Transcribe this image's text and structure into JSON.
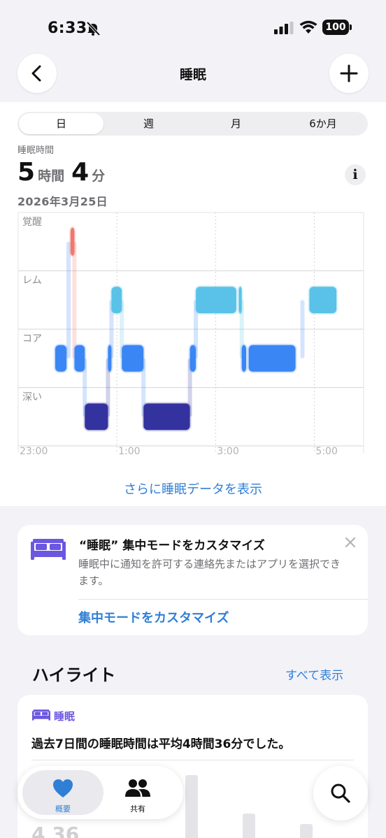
{
  "status_bar": {
    "time": "6:33",
    "battery": "100",
    "icons": [
      "bell-slash-icon",
      "signal-icon",
      "wifi-icon",
      "battery-icon"
    ]
  },
  "nav": {
    "title": "睡眠",
    "back_icon": "chevron-left-icon",
    "add_icon": "plus-icon"
  },
  "segments": [
    "日",
    "週",
    "月",
    "6か月"
  ],
  "selected_segment": "日",
  "summary": {
    "label": "睡眠時間",
    "hours": "5",
    "hours_unit": "時間",
    "minutes": "4",
    "minutes_unit": "分",
    "date": "2026年3月25日",
    "info_label": "i"
  },
  "chart_data": {
    "type": "bar",
    "stages": [
      "覚醒",
      "レム",
      "コア",
      "深い"
    ],
    "x_ticks": [
      "23:00",
      "1:00",
      "3:00",
      "5:00"
    ],
    "segments": [
      {
        "stage": "コア",
        "start": 23.75,
        "end": 23.98
      },
      {
        "stage": "覚醒",
        "start": 24.06,
        "end": 24.14
      },
      {
        "stage": "コア",
        "start": 24.14,
        "end": 24.35
      },
      {
        "stage": "深い",
        "start": 24.35,
        "end": 24.82
      },
      {
        "stage": "コア",
        "start": 24.82,
        "end": 24.89
      },
      {
        "stage": "レム",
        "start": 24.89,
        "end": 25.1
      },
      {
        "stage": "コア",
        "start": 25.1,
        "end": 25.54
      },
      {
        "stage": "深い",
        "start": 25.54,
        "end": 26.48
      },
      {
        "stage": "コア",
        "start": 26.48,
        "end": 26.6
      },
      {
        "stage": "レム",
        "start": 26.6,
        "end": 27.42
      },
      {
        "stage": "レム",
        "start": 27.47,
        "end": 27.53
      },
      {
        "stage": "コア",
        "start": 27.53,
        "end": 27.62
      },
      {
        "stage": "コア",
        "start": 27.67,
        "end": 28.62
      },
      {
        "stage": "レム",
        "start": 28.9,
        "end": 29.45
      }
    ],
    "colors": {
      "覚醒": "#f0786a",
      "レム": "#5ac2e8",
      "コア": "#3a86f5",
      "深い": "#34329e"
    },
    "grid": true
  },
  "more_link": "さらに睡眠データを表示",
  "focus_card": {
    "title": "“睡眠” 集中モードをカスタマイズ",
    "description": "睡眠中に通知を許可する連絡先またはアプリを選択できます。",
    "link": "集中モードをカスタマイズ",
    "icon": "bed-icon",
    "close_icon": "close-icon"
  },
  "highlights": {
    "title": "ハイライト",
    "show_all": "すべて表示",
    "card": {
      "category": "睡眠",
      "text": "過去7日間の睡眠時間は平均4時間36分でした。",
      "avg_hours": "4",
      "avg_minutes": "36"
    }
  },
  "tabbar": {
    "tabs": [
      {
        "label": "概要",
        "icon": "heart-icon",
        "active": true
      },
      {
        "label": "共有",
        "icon": "people-icon",
        "active": false
      }
    ],
    "search_icon": "search-icon"
  },
  "colors": {
    "accent": "#2f7fd6",
    "sleep_purple": "#6b57e0"
  }
}
